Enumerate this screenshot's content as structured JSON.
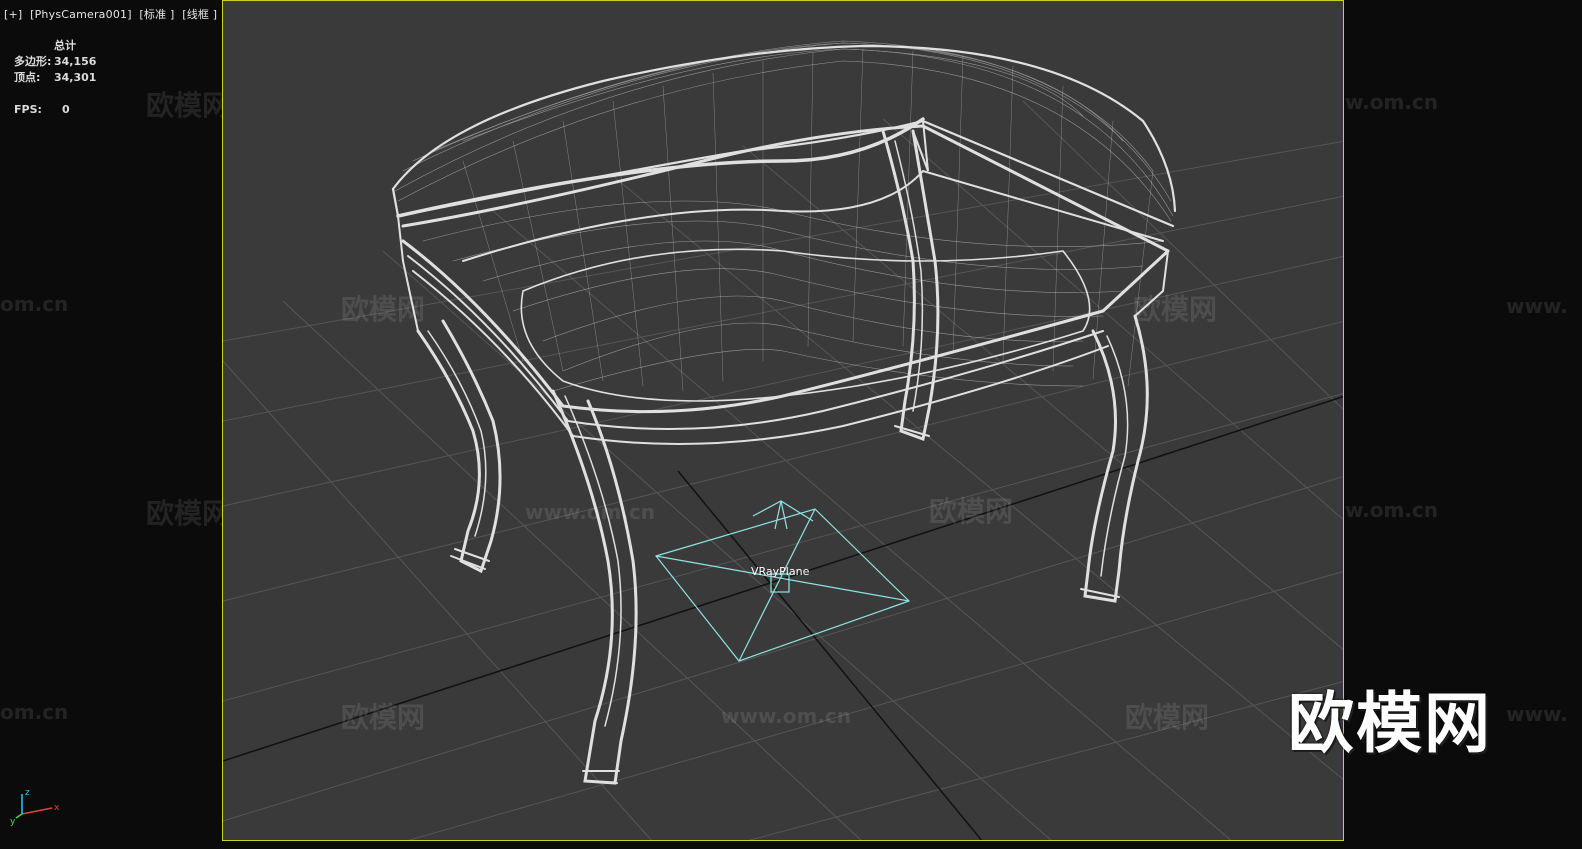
{
  "viewport_label": {
    "plus": "[+]",
    "camera": "[PhysCamera001]",
    "shading": "[标准 ]",
    "mode": "[线框 ]"
  },
  "stats": {
    "header": "总计",
    "polys_label": "多边形:",
    "polys_value": "34,156",
    "verts_label": "顶点:",
    "verts_value": "34,301",
    "fps_label": "FPS:",
    "fps_value": "0"
  },
  "scene": {
    "light_label": "VRayPlane",
    "wire_color": "#e8e8e8",
    "grid_color": "#5a5a5a",
    "light_color": "#8fe3e3",
    "frame_color": "#cfcf2a"
  },
  "watermarks": {
    "cn": "欧模网",
    "url": "www.om.cn",
    "url_short": "om.cn",
    "url_www": "www."
  },
  "logo": "欧模网",
  "axis": {
    "x": "x",
    "y": "y",
    "z": "z"
  }
}
